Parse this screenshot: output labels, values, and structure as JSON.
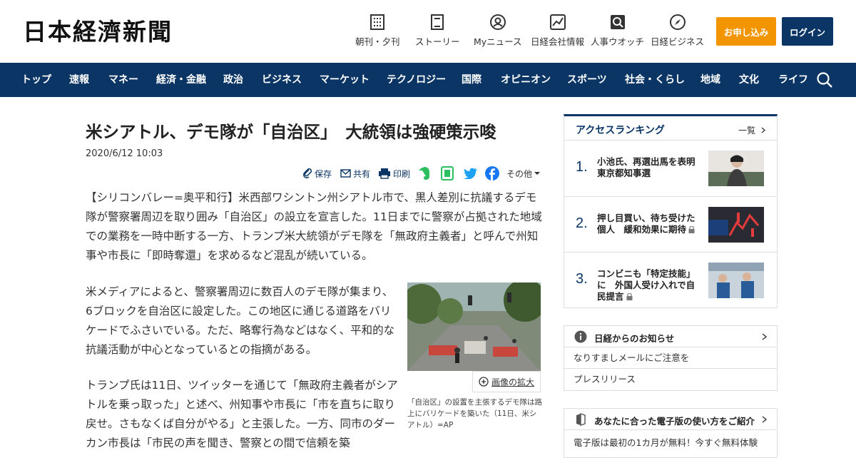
{
  "header": {
    "logo": "日本経濟新聞",
    "utilities": [
      {
        "label": "朝刊・夕刊",
        "icon": "newspaper-icon"
      },
      {
        "label": "ストーリー",
        "icon": "book-icon"
      },
      {
        "label": "Myニュース",
        "icon": "user-icon"
      },
      {
        "label": "日経会社情報",
        "icon": "chart-icon"
      },
      {
        "label": "人事ウオッチ",
        "icon": "search-person-icon"
      },
      {
        "label": "日経ビジネス",
        "icon": "compass-icon"
      }
    ],
    "apply_label": "お申し込み",
    "login_label": "ログイン"
  },
  "nav": {
    "items": [
      "トップ",
      "速報",
      "マネー",
      "経済・金融",
      "政治",
      "ビジネス",
      "マーケット",
      "テクノロジー",
      "国際",
      "オピニオン",
      "スポーツ",
      "社会・くらし",
      "地域",
      "文化",
      "ライフ"
    ]
  },
  "article": {
    "title": "米シアトル、デモ隊が「自治区」　大統領は強硬策示唆",
    "date": "2020/6/12 10:03",
    "tools": {
      "save": "保存",
      "share": "共有",
      "print": "印刷",
      "other": "その他"
    },
    "paragraphs": [
      "【シリコンバレー=奥平和行】米西部ワシントン州シアトル市で、黒人差別に抗議するデモ隊が警察署周辺を取り囲み「自治区」の設立を宣言した。11日までに警察が占拠された地域での業務を一時中断する一方、トランプ米大統領がデモ隊を「無政府主義者」と呼んで州知事や市長に「即時奪還」を求めるなど混乱が続いている。",
      "米メディアによると、警察署周辺に数百人のデモ隊が集まり、6ブロックを自治区に設定した。この地区に通じる道路をバリケードでふさいでいる。ただ、略奪行為などはなく、平和的な抗議活動が中心となっているとの指摘がある。",
      "トランプ氏は11日、ツイッターを通じて「無政府主義者がシアトルを乗っ取った」と述べ、州知事や市長に「市を直ちに取り戻せ。さもなくば自分がやる」と主張した。一方、同市のダーカン市長は「市民の声を聞き、警察との間で信頼を築"
    ],
    "image_zoom": "画像の拡大",
    "caption": "「自治区」の設置を主張するデモ隊は路上にバリケードを築いた（11日、米シアトル）=AP"
  },
  "sidebar": {
    "ranking": {
      "title": "アクセスランキング",
      "all": "一覧",
      "items": [
        {
          "num": "1.",
          "text": "小池氏、再選出馬を表明　東京都知事選",
          "locked": false
        },
        {
          "num": "2.",
          "text": "押し目買い、待ち受けた個人　緩和効果に期待",
          "locked": true
        },
        {
          "num": "3.",
          "text": "コンビニも「特定技能」に　外国人受け入れで自民提言",
          "locked": true
        }
      ]
    },
    "notices": {
      "title": "日経からのお知らせ",
      "items": [
        "なりすましメールにご注意を",
        "プレスリリース"
      ]
    },
    "denshi": {
      "title": "あなたに合った電子版の使い方をご紹介",
      "text": "電子版は最初の1カ月が無料！今すぐ無料体験"
    }
  },
  "colors": {
    "brand_navy": "#0a3565",
    "apply_orange": "#f29500"
  }
}
